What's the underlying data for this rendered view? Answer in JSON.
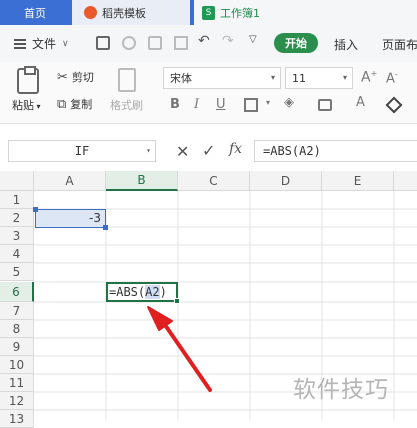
{
  "tabs": [
    {
      "label": "首页"
    },
    {
      "label": "稻壳模板"
    },
    {
      "label": "工作簿1",
      "icon": "S"
    }
  ],
  "menubar": {
    "file": "文件",
    "start": "开始",
    "insert": "插入",
    "layout": "页面布"
  },
  "ribbon": {
    "paste": "粘贴",
    "cut": "剪切",
    "copy": "复制",
    "format_painter": "格式刷",
    "font_name": "宋体",
    "font_size": "11"
  },
  "formula_bar": {
    "name_box": "IF",
    "formula": "=ABS(A2)"
  },
  "grid": {
    "columns": [
      "A",
      "B",
      "C",
      "D",
      "E"
    ],
    "rows": [
      "1",
      "2",
      "3",
      "4",
      "5",
      "6",
      "7",
      "8",
      "9",
      "10",
      "11",
      "12",
      "13"
    ],
    "cell_a2": "-3",
    "cell_b6_prefix": "=ABS(",
    "cell_b6_ref": "A2",
    "cell_b6_suffix": ")"
  },
  "watermark": "软件技巧",
  "colors": {
    "accent_green": "#217346",
    "tab_blue": "#3c6fd3",
    "start_button": "#2a8f4c",
    "selection_blue": "#3b6fc1",
    "arrow_red": "#e02020"
  }
}
